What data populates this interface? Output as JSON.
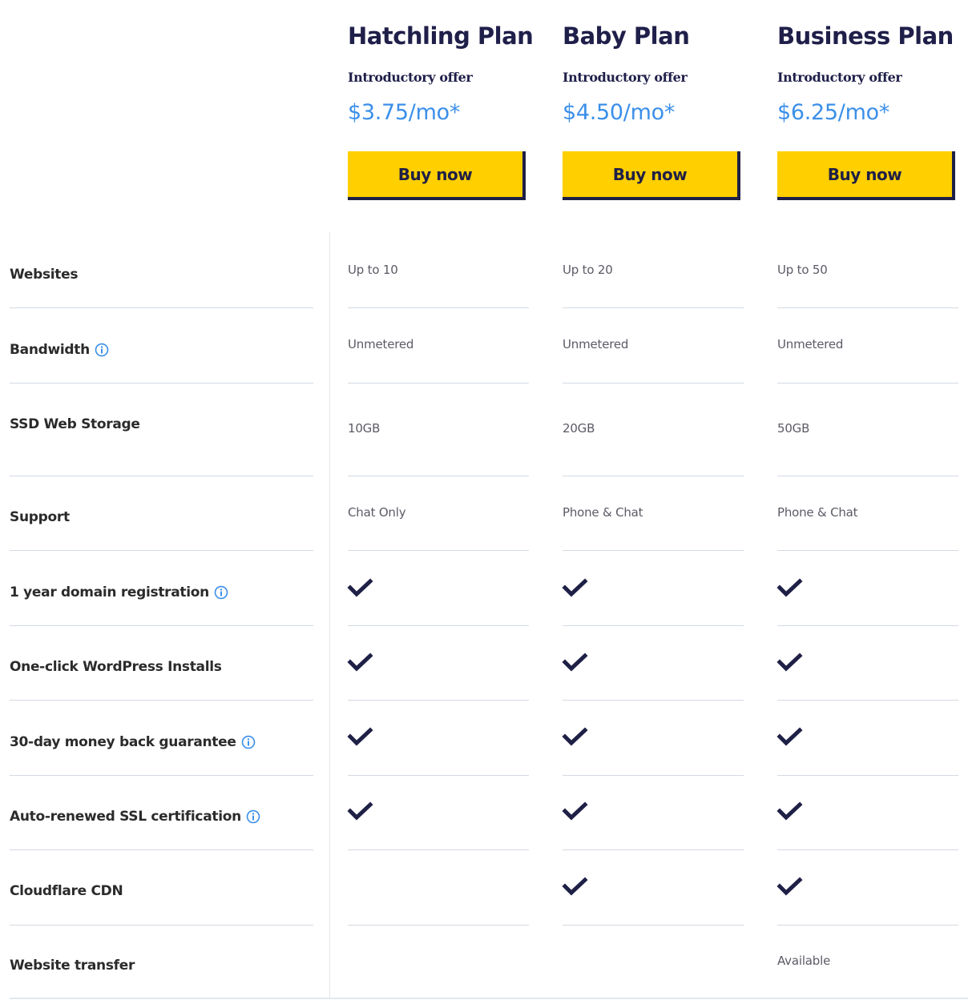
{
  "colors": {
    "title": "#1f1f4a",
    "price": "#3b8fe9",
    "button_bg": "#ffcf00",
    "button_shadow": "#1f2046",
    "check": "#1f2046",
    "info_icon": "#3b8fe9",
    "divider": "#d3dae2"
  },
  "plans": [
    {
      "name": "Hatchling Plan",
      "offer_label": "Introductory offer",
      "price": "$3.75/mo*",
      "button_label": "Buy now"
    },
    {
      "name": "Baby Plan",
      "offer_label": "Introductory offer",
      "price": "$4.50/mo*",
      "button_label": "Buy now"
    },
    {
      "name": "Business Plan",
      "offer_label": "Introductory offer",
      "price": "$6.25/mo*",
      "button_label": "Buy now"
    }
  ],
  "features": [
    {
      "label": "Websites",
      "info": false,
      "values": [
        {
          "type": "text",
          "text": "Up to 10"
        },
        {
          "type": "text",
          "text": "Up to 20"
        },
        {
          "type": "text",
          "text": "Up to 50"
        }
      ]
    },
    {
      "label": "Bandwidth",
      "info": true,
      "values": [
        {
          "type": "text",
          "text": "Unmetered"
        },
        {
          "type": "text",
          "text": "Unmetered"
        },
        {
          "type": "text",
          "text": "Unmetered"
        }
      ]
    },
    {
      "label": "SSD Web Storage",
      "info": false,
      "values": [
        {
          "type": "text",
          "text": "10GB"
        },
        {
          "type": "text",
          "text": "20GB"
        },
        {
          "type": "text",
          "text": "50GB"
        }
      ]
    },
    {
      "label": "Support",
      "info": false,
      "values": [
        {
          "type": "text",
          "text": "Chat Only"
        },
        {
          "type": "text",
          "text": "Phone & Chat"
        },
        {
          "type": "text",
          "text": "Phone & Chat"
        }
      ]
    },
    {
      "label": "1 year domain registration",
      "info": true,
      "values": [
        {
          "type": "check"
        },
        {
          "type": "check"
        },
        {
          "type": "check"
        }
      ]
    },
    {
      "label": "One-click WordPress Installs",
      "info": false,
      "values": [
        {
          "type": "check"
        },
        {
          "type": "check"
        },
        {
          "type": "check"
        }
      ]
    },
    {
      "label": "30-day money back guarantee",
      "info": true,
      "values": [
        {
          "type": "check"
        },
        {
          "type": "check"
        },
        {
          "type": "check"
        }
      ]
    },
    {
      "label": "Auto-renewed SSL certification",
      "info": true,
      "values": [
        {
          "type": "check"
        },
        {
          "type": "check"
        },
        {
          "type": "check"
        }
      ]
    },
    {
      "label": "Cloudflare CDN",
      "info": false,
      "values": [
        {
          "type": "none"
        },
        {
          "type": "check"
        },
        {
          "type": "check"
        }
      ]
    },
    {
      "label": "Website transfer",
      "info": false,
      "values": [
        {
          "type": "none"
        },
        {
          "type": "none"
        },
        {
          "type": "text",
          "text": "Available"
        }
      ]
    }
  ]
}
